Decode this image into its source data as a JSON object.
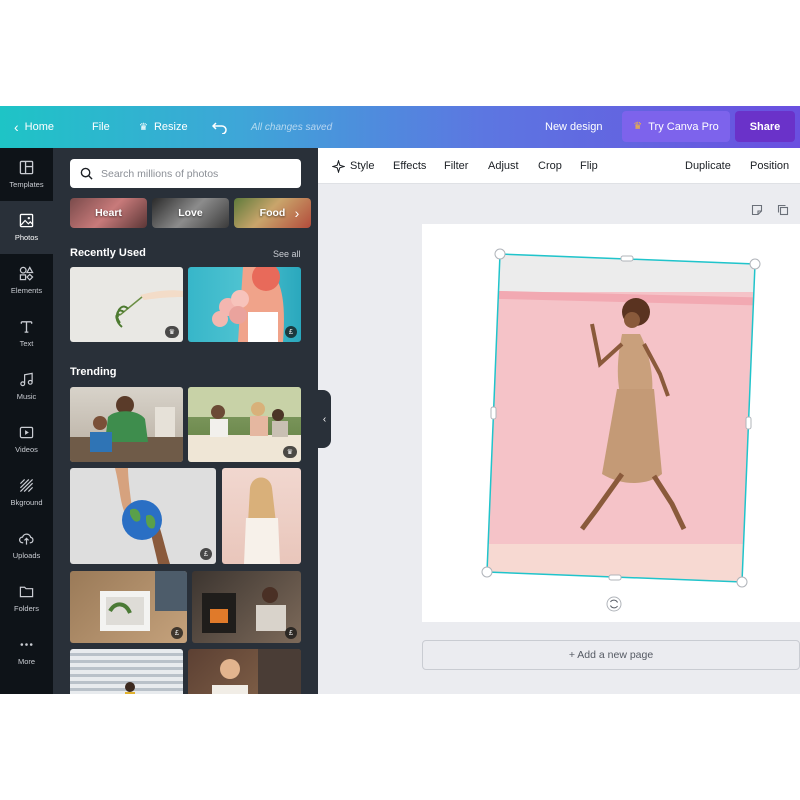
{
  "topbar": {
    "home": "Home",
    "file": "File",
    "resize": "Resize",
    "saved": "All changes saved",
    "new_design": "New design",
    "try_pro": "Try Canva Pro",
    "share": "Share"
  },
  "rail": {
    "items": [
      {
        "label": "Templates",
        "icon": "templates-icon"
      },
      {
        "label": "Photos",
        "icon": "photos-icon"
      },
      {
        "label": "Elements",
        "icon": "elements-icon"
      },
      {
        "label": "Text",
        "icon": "text-icon"
      },
      {
        "label": "Music",
        "icon": "music-icon"
      },
      {
        "label": "Videos",
        "icon": "videos-icon"
      },
      {
        "label": "Bkground",
        "icon": "background-icon"
      },
      {
        "label": "Uploads",
        "icon": "uploads-icon"
      },
      {
        "label": "Folders",
        "icon": "folders-icon"
      },
      {
        "label": "More",
        "icon": "more-icon"
      }
    ],
    "active": "Photos"
  },
  "panel": {
    "search_placeholder": "Search millions of photos",
    "chips": [
      "Heart",
      "Love",
      "Food"
    ],
    "recently_used": "Recently Used",
    "see_all": "See all",
    "trending": "Trending",
    "badge_pound": "£",
    "badge_crown": "♛"
  },
  "toolbar": {
    "style": "Style",
    "effects": "Effects",
    "filter": "Filter",
    "adjust": "Adjust",
    "crop": "Crop",
    "flip": "Flip",
    "duplicate": "Duplicate",
    "position": "Position"
  },
  "canvas": {
    "add_page": "+ Add a new page"
  },
  "colors": {
    "accent": "#20c4cb",
    "panel": "#293039",
    "rail": "#0e1318",
    "share": "#6a32c9"
  }
}
